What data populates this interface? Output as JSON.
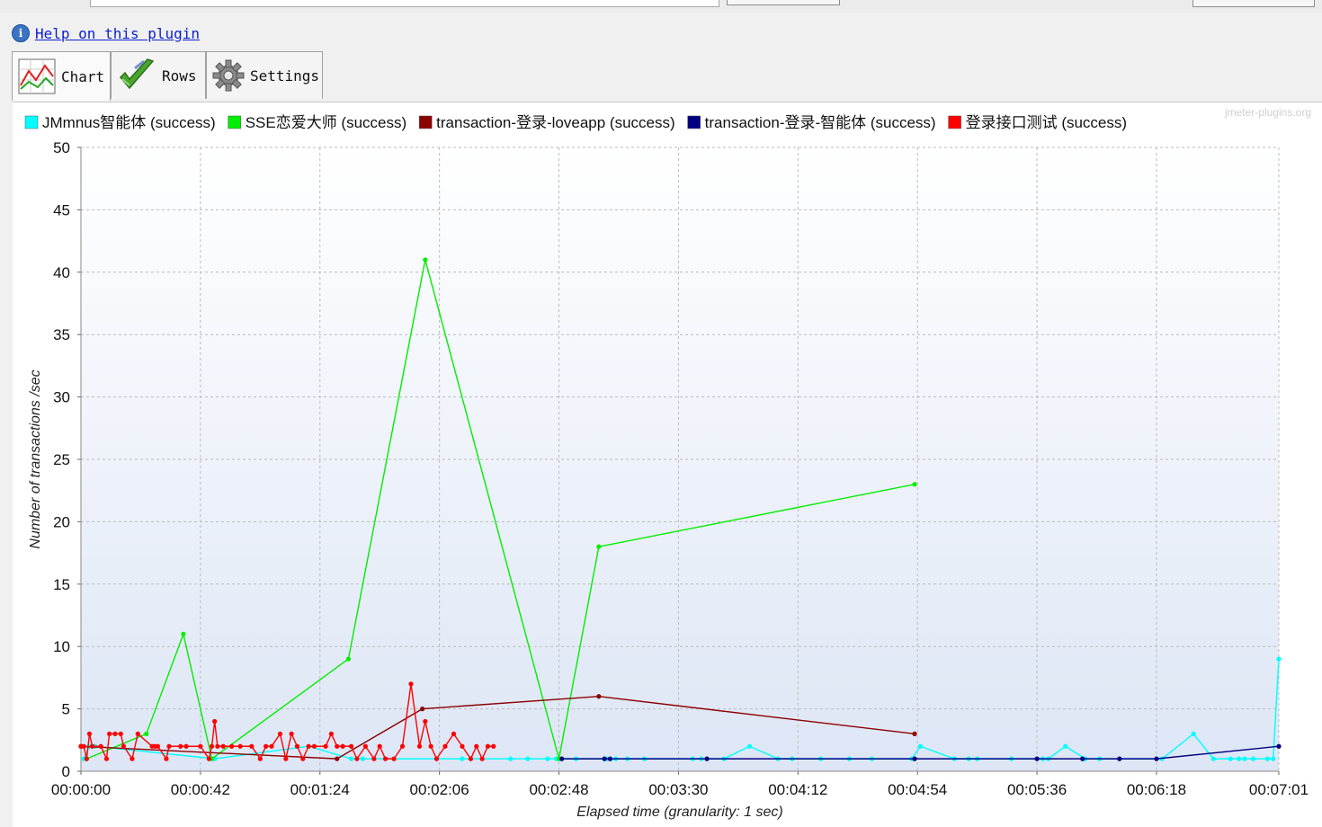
{
  "help": {
    "link_text": "Help on this plugin"
  },
  "tabs": [
    {
      "label": "Chart",
      "icon": "line-chart-icon"
    },
    {
      "label": "Rows",
      "icon": "checkmark-icon"
    },
    {
      "label": "Settings",
      "icon": "gear-icon"
    }
  ],
  "chart_data": {
    "type": "line",
    "watermark": "jmeter-plugins.org",
    "xlabel": "Elapsed time (granularity: 1 sec)",
    "ylabel": "Number of transactions /sec",
    "ylim": [
      0,
      50
    ],
    "yticks": [
      0,
      5,
      10,
      15,
      20,
      25,
      30,
      35,
      40,
      45,
      50
    ],
    "xlim": [
      "00:00:00",
      "00:07:01"
    ],
    "xticks": [
      "00:00:00",
      "00:00:42",
      "00:01:24",
      "00:02:06",
      "00:02:48",
      "00:03:30",
      "00:04:12",
      "00:04:54",
      "00:05:36",
      "00:06:18",
      "00:07:01"
    ],
    "grid": true,
    "legend_position": "top",
    "background": "gradient white to light blue",
    "series": [
      {
        "name": "JMmnus智能体 (success)",
        "color": "#00ffff",
        "x": [
          "00:00:01",
          "00:00:03",
          "00:00:05",
          "00:00:47",
          "00:01:20",
          "00:01:35",
          "00:01:39",
          "00:02:05",
          "00:02:14",
          "00:02:31",
          "00:02:37",
          "00:02:44",
          "00:02:47",
          "00:02:54",
          "00:03:05",
          "00:03:08",
          "00:03:12",
          "00:03:18",
          "00:03:35",
          "00:03:38",
          "00:03:46",
          "00:03:55",
          "00:04:05",
          "00:04:10",
          "00:04:20",
          "00:04:30",
          "00:04:38",
          "00:04:52",
          "00:04:55",
          "00:05:07",
          "00:05:12",
          "00:05:15",
          "00:05:27",
          "00:05:38",
          "00:05:40",
          "00:05:46",
          "00:05:53",
          "00:05:58",
          "00:06:20",
          "00:06:31",
          "00:06:38",
          "00:06:44",
          "00:06:47",
          "00:06:49",
          "00:06:52",
          "00:06:57",
          "00:06:59",
          "00:07:01"
        ],
        "y": [
          1,
          2,
          2,
          1,
          2,
          1,
          1,
          1,
          1,
          1,
          1,
          1,
          1,
          1,
          1,
          1,
          1,
          1,
          1,
          1,
          1,
          2,
          1,
          1,
          1,
          1,
          1,
          1,
          2,
          1,
          1,
          1,
          1,
          1,
          1,
          2,
          1,
          1,
          1,
          3,
          1,
          1,
          1,
          1,
          1,
          1,
          1,
          9
        ]
      },
      {
        "name": "SSE恋爱大师 (success)",
        "color": "#00ee00",
        "x": [
          "00:00:02",
          "00:00:23",
          "00:00:36",
          "00:00:46",
          "00:01:34",
          "00:02:01",
          "00:02:48",
          "00:03:02",
          "00:04:53"
        ],
        "y": [
          1,
          3,
          11,
          1,
          9,
          41,
          1,
          18,
          23
        ]
      },
      {
        "name": "transaction-登录-loveapp (success)",
        "color": "#8b0000",
        "x": [
          "00:00:00",
          "00:01:30",
          "00:02:00",
          "00:03:02",
          "00:04:53"
        ],
        "y": [
          2,
          1,
          5,
          6,
          3
        ]
      },
      {
        "name": "transaction-登录-智能体 (success)",
        "color": "#000080",
        "x": [
          "00:02:49",
          "00:03:04",
          "00:03:06",
          "00:03:40",
          "00:04:53",
          "00:05:36",
          "00:05:52",
          "00:06:05",
          "00:06:18",
          "00:07:01"
        ],
        "y": [
          1,
          1,
          1,
          1,
          1,
          1,
          1,
          1,
          1,
          2
        ]
      },
      {
        "name": "登录接口测试 (success)",
        "color": "#ff0000",
        "x": [
          "00:00:00",
          "00:00:01",
          "00:00:02",
          "00:00:03",
          "00:00:04",
          "00:00:07",
          "00:00:09",
          "00:00:10",
          "00:00:12",
          "00:00:14",
          "00:00:15",
          "00:00:18",
          "00:00:20",
          "00:00:25",
          "00:00:26",
          "00:00:27",
          "00:00:30",
          "00:00:31",
          "00:00:35",
          "00:00:37",
          "00:00:42",
          "00:00:45",
          "00:00:46",
          "00:00:47",
          "00:00:48",
          "00:00:50",
          "00:00:53",
          "00:00:56",
          "00:01:00",
          "00:01:03",
          "00:01:05",
          "00:01:07",
          "00:01:10",
          "00:01:12",
          "00:01:14",
          "00:01:16",
          "00:01:18",
          "00:01:20",
          "00:01:22",
          "00:01:26",
          "00:01:28",
          "00:01:30",
          "00:01:32",
          "00:01:35",
          "00:01:37",
          "00:01:40",
          "00:01:43",
          "00:01:45",
          "00:01:47",
          "00:01:50",
          "00:01:53",
          "00:01:56",
          "00:01:59",
          "00:02:01",
          "00:02:03",
          "00:02:05",
          "00:02:08",
          "00:02:11",
          "00:02:14",
          "00:02:17",
          "00:02:19",
          "00:02:21",
          "00:02:23",
          "00:02:25"
        ],
        "y": [
          2,
          2,
          1,
          3,
          2,
          2,
          1,
          3,
          3,
          3,
          2,
          1,
          3,
          2,
          2,
          2,
          1,
          2,
          2,
          2,
          2,
          1,
          2,
          4,
          2,
          2,
          2,
          2,
          2,
          1,
          2,
          2,
          3,
          1,
          3,
          2,
          1,
          2,
          2,
          2,
          3,
          2,
          2,
          2,
          1,
          2,
          1,
          2,
          1,
          1,
          2,
          7,
          2,
          4,
          2,
          1,
          2,
          3,
          2,
          1,
          2,
          1,
          2,
          2
        ]
      }
    ]
  }
}
